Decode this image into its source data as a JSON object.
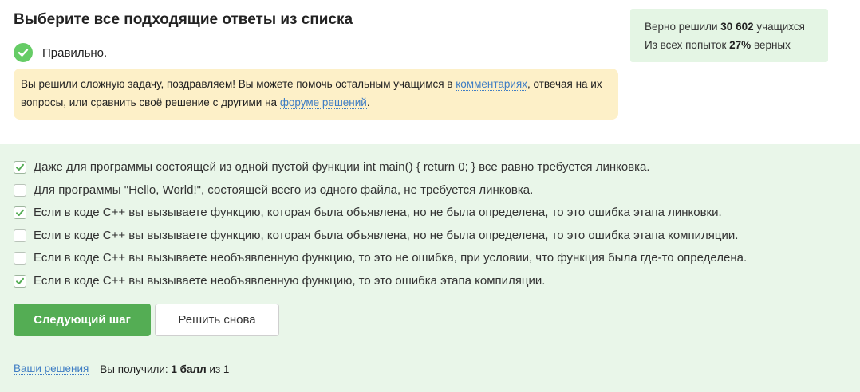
{
  "header": {
    "title": "Выберите все подходящие ответы из списка",
    "correct_label": "Правильно."
  },
  "congrats": {
    "text_1": "Вы решили сложную задачу, поздравляем! Вы можете помочь остальным учащимся в ",
    "link_comments": "комментариях",
    "text_2": ", отвечая на их вопросы, или сравнить своё решение с другими на ",
    "link_forum": "форуме решений",
    "text_3": "."
  },
  "stats": {
    "line1_prefix": "Верно решили ",
    "line1_count": "30 602",
    "line1_suffix": " учащихся",
    "line2_prefix": "Из всех попыток ",
    "line2_percent": "27%",
    "line2_suffix": " верных"
  },
  "options": [
    {
      "label": "Даже для программы состоящей из одной пустой функции int main() { return 0; } все равно требуется линковка.",
      "checked": true
    },
    {
      "label": "Для программы \"Hello, World!\", состоящей всего из одного файла, не требуется линковка.",
      "checked": false
    },
    {
      "label": "Если в коде C++ вы вызываете функцию, которая была объявлена, но не была определена, то это ошибка этапа линковки.",
      "checked": true
    },
    {
      "label": "Если в коде C++ вы вызываете функцию, которая была объявлена, но не была определена, то это ошибка этапа компиляции.",
      "checked": false
    },
    {
      "label": "Если в коде C++ вы вызываете необъявленную функцию, то это не ошибка, при условии, что функция была где-то определена.",
      "checked": false
    },
    {
      "label": "Если в коде C++ вы вызываете необъявленную функцию, то это ошибка этапа компиляции.",
      "checked": true
    }
  ],
  "buttons": {
    "next": "Следующий шаг",
    "retry": "Решить снова"
  },
  "footer": {
    "solutions_link": "Ваши решения",
    "score_prefix": "Вы получили: ",
    "score_value": "1 балл",
    "score_suffix": " из 1"
  },
  "colors": {
    "accent_green": "#54ad54",
    "answers_bg": "#e9f6e9",
    "congrats_bg": "#fdf0c8",
    "link": "#3f7dc4"
  }
}
